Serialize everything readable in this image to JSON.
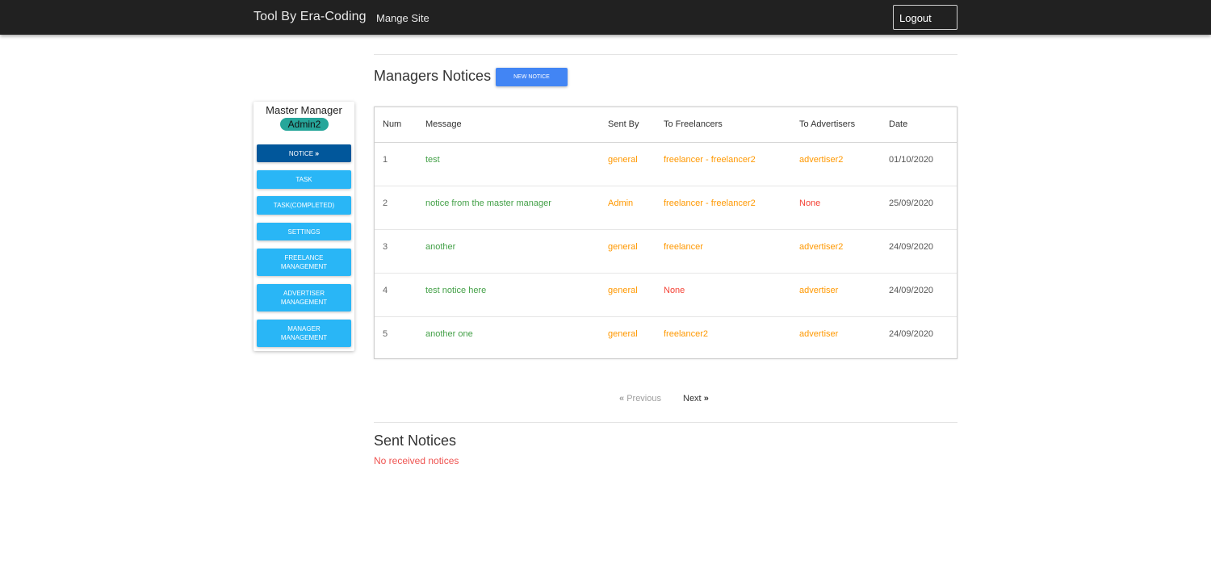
{
  "navbar": {
    "brand": "Tool By Era-Coding",
    "link": "Mange Site",
    "logout": "Logout"
  },
  "sidebar": {
    "title": "Master Manager",
    "badge": "Admin2",
    "items": [
      {
        "label": "Notice",
        "active": true,
        "icon": "double-chevron-right-icon"
      },
      {
        "label": "Task",
        "active": false
      },
      {
        "label": "Task(Completed)",
        "active": false
      },
      {
        "label": "Settings",
        "active": false
      },
      {
        "label": "Freelance Management",
        "active": false
      },
      {
        "label": "Advertiser Management",
        "active": false
      },
      {
        "label": "Manager Management",
        "active": false
      }
    ]
  },
  "notices": {
    "title": "Managers Notices",
    "new_button": "New Notice",
    "columns": [
      "Num",
      "Message",
      "Sent By",
      "To Freelancers",
      "To Advertisers",
      "Date"
    ],
    "rows": [
      {
        "num": "1",
        "message": "test",
        "sent_by": "general",
        "to_freelancers": "freelancer - freelancer2",
        "to_advertisers": "advertiser2",
        "date": "01/10/2020"
      },
      {
        "num": "2",
        "message": "notice from the master manager",
        "sent_by": "Admin",
        "to_freelancers": "freelancer - freelancer2",
        "to_advertisers": "None",
        "date": "25/09/2020"
      },
      {
        "num": "3",
        "message": "another",
        "sent_by": "general",
        "to_freelancers": "freelancer",
        "to_advertisers": "advertiser2",
        "date": "24/09/2020"
      },
      {
        "num": "4",
        "message": "test notice here",
        "sent_by": "general",
        "to_freelancers": "None",
        "to_advertisers": "advertiser",
        "date": "24/09/2020"
      },
      {
        "num": "5",
        "message": "another one",
        "sent_by": "general",
        "to_freelancers": "freelancer2",
        "to_advertisers": "advertiser",
        "date": "24/09/2020"
      }
    ]
  },
  "pagination": {
    "previous": "Previous",
    "next": "Next",
    "previous_disabled": true
  },
  "sent": {
    "title": "Sent Notices",
    "empty": "No received notices"
  },
  "colors": {
    "navbar": "#212121",
    "sidebar_button": "#29b6f6",
    "sidebar_active": "#01579b",
    "badge": "#26a69a",
    "new_button": "#4285f4",
    "message_green": "#43a047",
    "value_orange": "#ff9800",
    "none_red": "#f44336"
  }
}
